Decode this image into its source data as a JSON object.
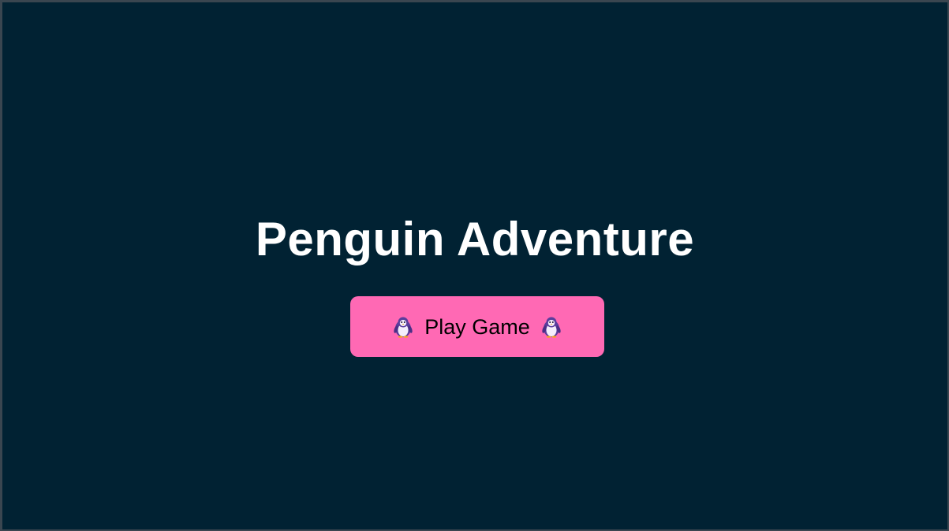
{
  "game": {
    "title": "Penguin Adventure",
    "play_button": {
      "label": "Play Game",
      "left_icon": "penguin-icon",
      "right_icon": "penguin-icon"
    }
  },
  "colors": {
    "background": "#012233",
    "title_text": "#ffffff",
    "button_background": "#ff69b4",
    "button_text": "#000000"
  }
}
